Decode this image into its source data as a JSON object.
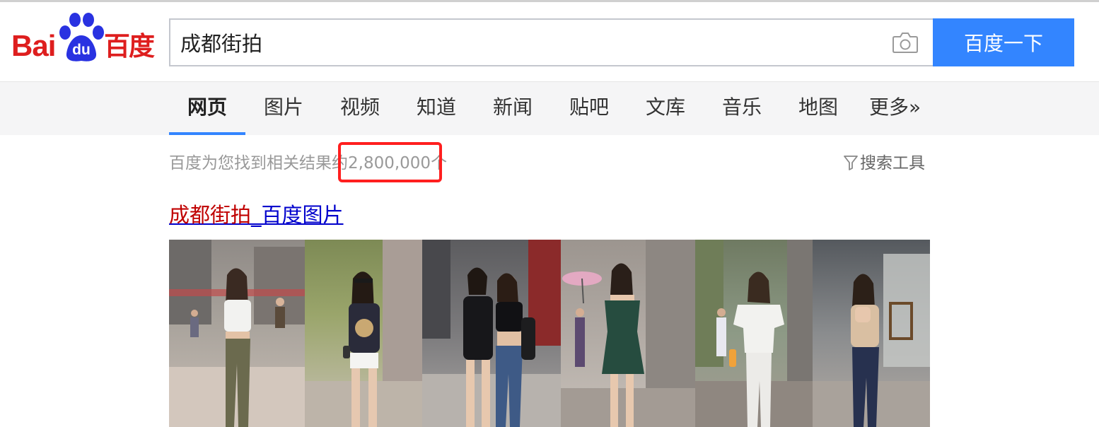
{
  "header": {
    "logo": {
      "text_left": "Bai",
      "text_mid": "du",
      "text_right": "百度",
      "color": "#de1e1e",
      "paw_color": "#2932e1"
    },
    "search": {
      "value": "成都街拍",
      "camera_icon": "camera-icon"
    },
    "search_button_label": "百度一下",
    "accent_color": "#3385ff"
  },
  "tabs": [
    {
      "label": "网页",
      "active": true
    },
    {
      "label": "图片",
      "active": false
    },
    {
      "label": "视频",
      "active": false
    },
    {
      "label": "知道",
      "active": false
    },
    {
      "label": "新闻",
      "active": false
    },
    {
      "label": "贴吧",
      "active": false
    },
    {
      "label": "文库",
      "active": false
    },
    {
      "label": "音乐",
      "active": false
    },
    {
      "label": "地图",
      "active": false
    },
    {
      "label": "更多»",
      "active": false
    }
  ],
  "results_info": {
    "prefix": "百度为您找到相关结果约",
    "count": "2,800,000",
    "suffix": "个",
    "highlight_color": "#ff1f1f",
    "tools_label": "搜索工具",
    "tools_icon": "filter-icon"
  },
  "result": {
    "title_highlight": "成都街拍",
    "title_rest": "_百度图片",
    "thumbnails": [
      {
        "name": "street-photo-1"
      },
      {
        "name": "street-photo-2"
      },
      {
        "name": "street-photo-3"
      },
      {
        "name": "street-photo-4"
      },
      {
        "name": "street-photo-5"
      },
      {
        "name": "street-photo-6"
      }
    ]
  }
}
